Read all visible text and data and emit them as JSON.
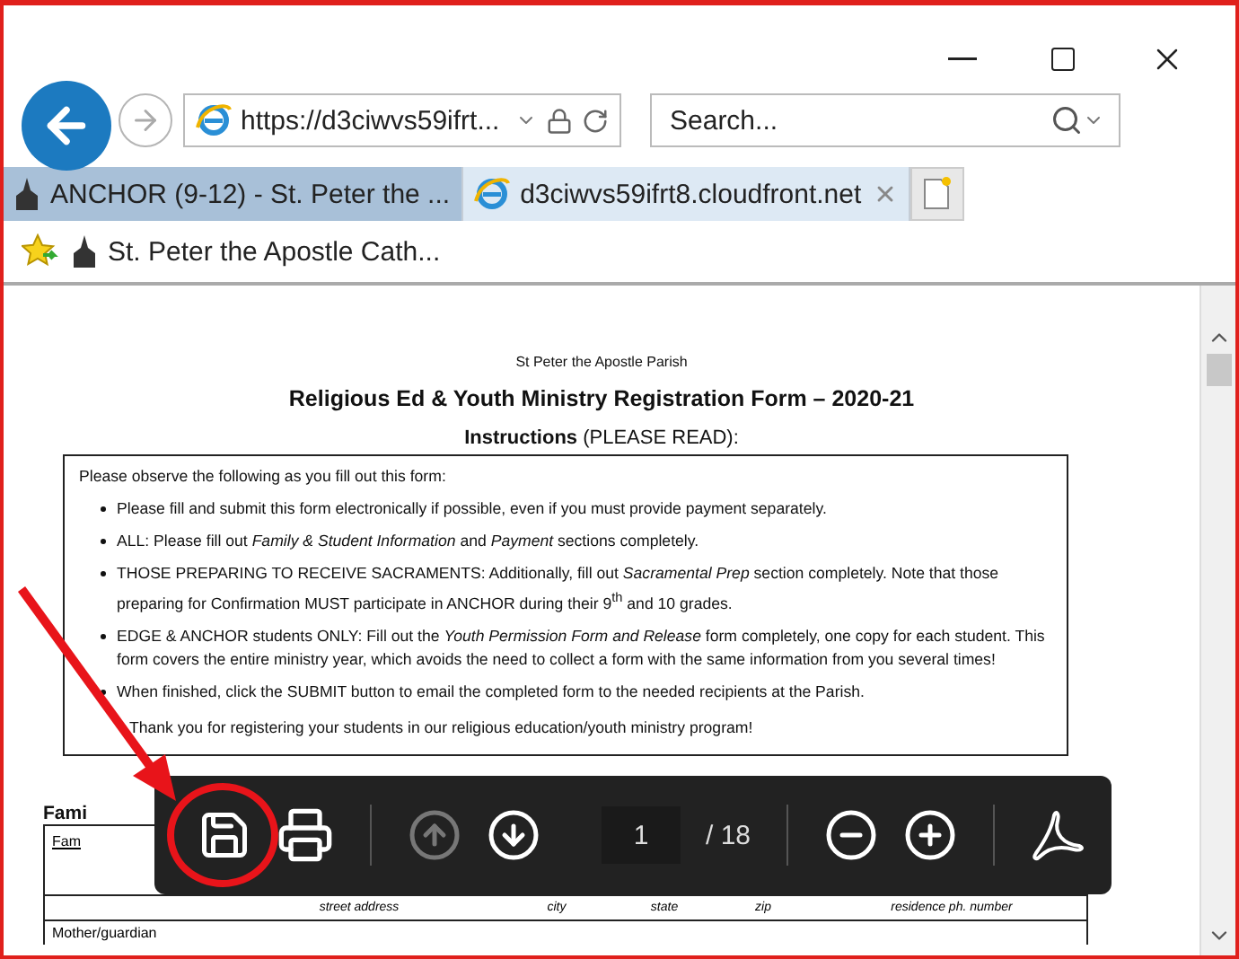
{
  "address_bar": {
    "url": "https://d3ciwvs59ifrt..."
  },
  "search": {
    "placeholder": "Search..."
  },
  "tabs": [
    {
      "label": "ANCHOR (9-12) - St. Peter the ...",
      "selected": false,
      "closable": false
    },
    {
      "label": "d3ciwvs59ifrt8.cloudfront.net",
      "selected": true,
      "closable": true
    }
  ],
  "favorites": [
    {
      "label": "St. Peter the Apostle Cath..."
    }
  ],
  "document": {
    "parish": "St Peter the Apostle Parish",
    "title": "Religious Ed & Youth Ministry Registration Form – 2020-21",
    "instructions_heading": "**Instructions** (PLEASE READ):",
    "intro": "Please observe the following as you fill out this form:",
    "bullets": [
      "Please fill and submit this form electronically if possible, even if you must provide payment separately.",
      "ALL: Please fill out *Family & Student Information* and *Payment* sections completely.",
      "THOSE PREPARING TO RECEIVE SACRAMENTS: Additionally, fill out *Sacramental Prep* section completely. Note that those preparing for Confirmation MUST participate in ANCHOR during their 9$^{th}$ and 10 grades.",
      "EDGE & ANCHOR students ONLY: Fill out the *Youth Permission Form and Release* form completely, one copy for each student. This form covers the entire ministry year, which avoids the need to collect a form with the same information from you several times!",
      "When finished, click the SUBMIT button to email the completed form to the needed recipients at the Parish."
    ],
    "closing": "Thank you for registering your students in our religious education/youth ministry program!",
    "section_heading": "Fami",
    "table_label": "Fam",
    "address_labels": [
      "street address",
      "city",
      "state",
      "zip",
      "residence ph. number"
    ],
    "row_label": "Mother/guardian"
  },
  "pdf_toolbar": {
    "previous_disabled": true,
    "next_disabled": false,
    "page": "1",
    "total": "/ 18"
  }
}
